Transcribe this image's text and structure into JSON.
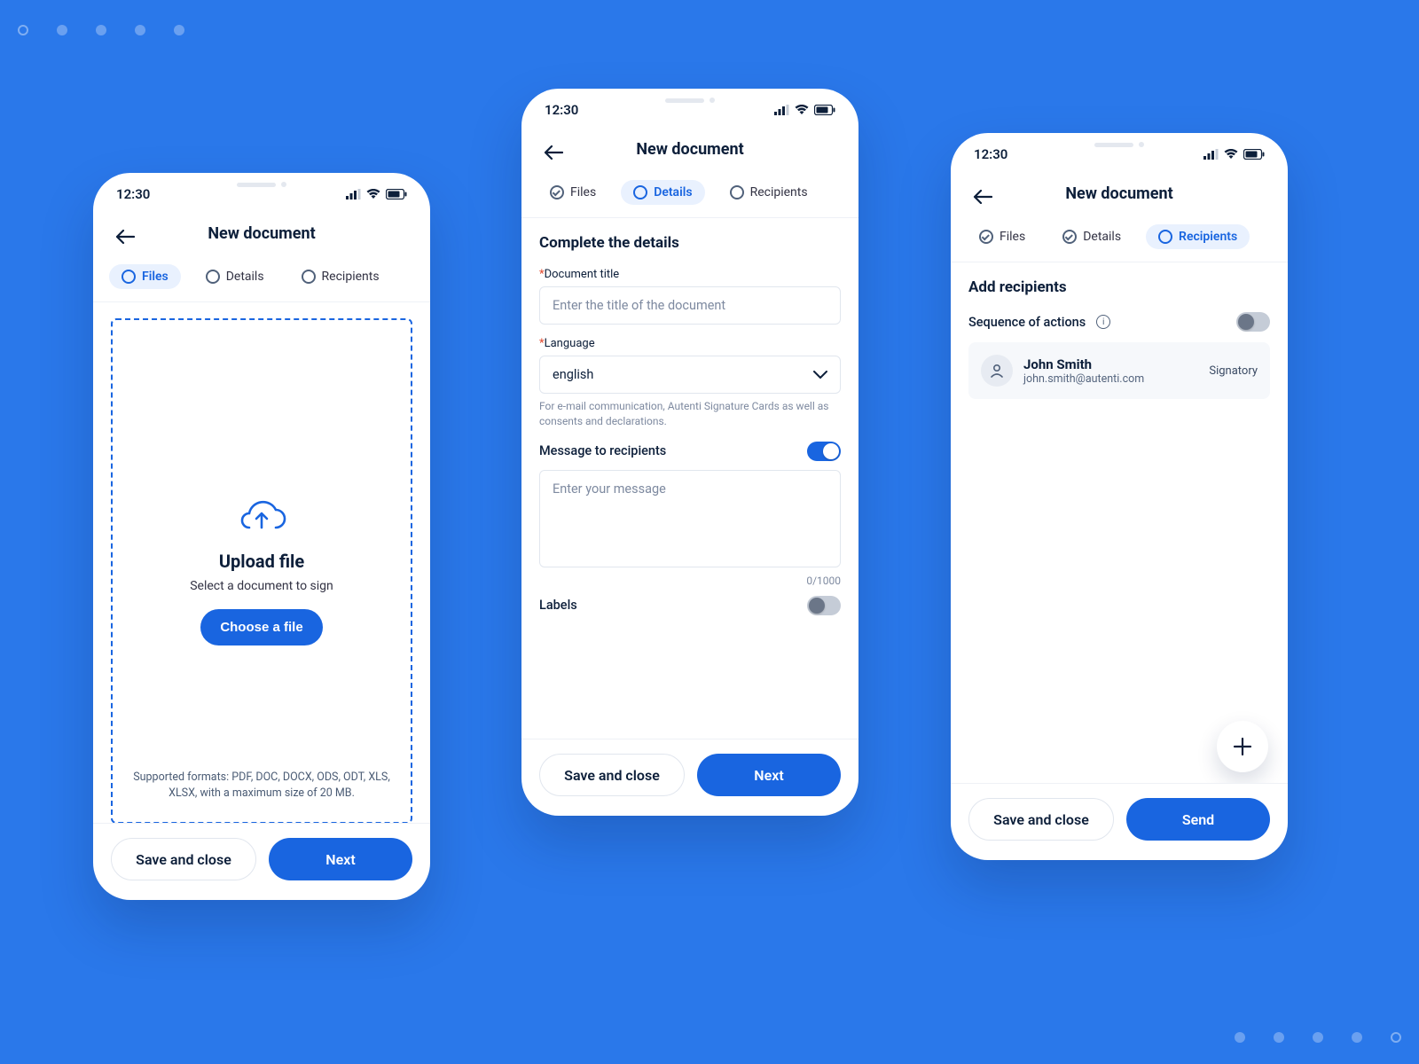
{
  "status": {
    "time": "12:30"
  },
  "header": {
    "title": "New document"
  },
  "tabs": {
    "files": "Files",
    "details": "Details",
    "recipients": "Recipients"
  },
  "footer": {
    "save": "Save and close",
    "next": "Next",
    "send": "Send"
  },
  "screen1": {
    "upload_title": "Upload file",
    "upload_sub": "Select a document to sign",
    "choose": "Choose a file",
    "support": "Supported formats: PDF, DOC, DOCX, ODS, ODT, XLS, XLSX, with a maximum size of 20 MB."
  },
  "screen2": {
    "section": "Complete the details",
    "doc_title_label": "Document title",
    "doc_title_ph": "Enter the title of the document",
    "lang_label": "Language",
    "lang_value": "english",
    "lang_help": "For e-mail communication, Autenti Signature Cards as well as consents and declarations.",
    "msg_label": "Message to recipients",
    "msg_ph": "Enter your message",
    "counter": "0/1000",
    "labels_label": "Labels"
  },
  "screen3": {
    "section": "Add recipients",
    "seq_label": "Sequence of actions",
    "recipient": {
      "name": "John Smith",
      "email": "john.smith@autenti.com",
      "role": "Signatory"
    }
  }
}
